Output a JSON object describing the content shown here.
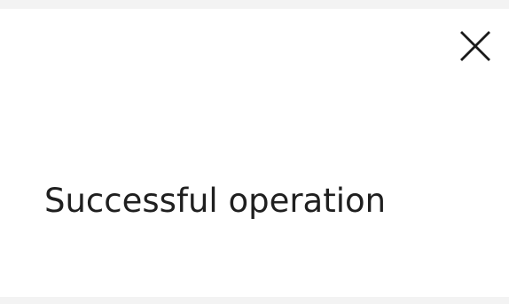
{
  "dialog": {
    "message": "Successful operation",
    "close_icon": "close-icon"
  }
}
